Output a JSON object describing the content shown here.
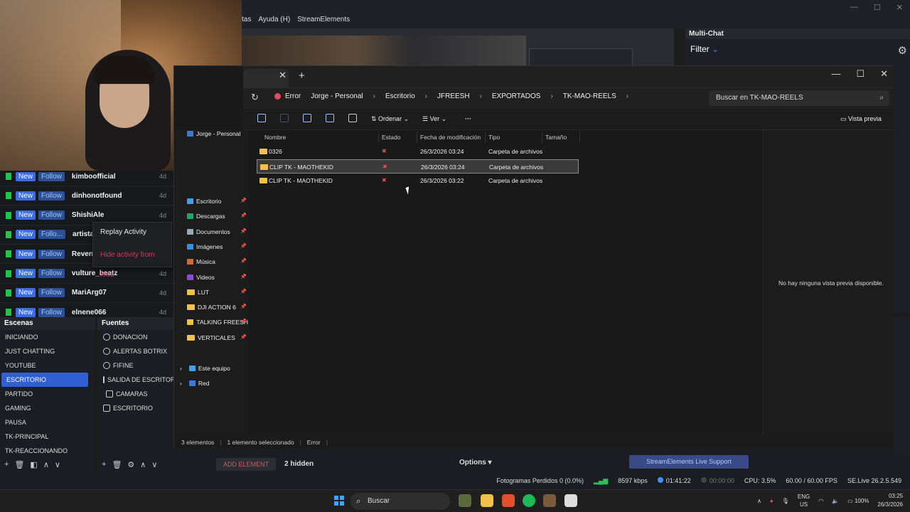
{
  "obs": {
    "menu": [
      "tas",
      "Ayuda (H)",
      "StreamElements"
    ],
    "feed": [
      {
        "badge_new": "New",
        "badge_follow": "Follow",
        "name": "kimboofficial",
        "time": "4d"
      },
      {
        "badge_new": "New",
        "badge_follow": "Follow",
        "name": "dinhonotfound",
        "time": "4d"
      },
      {
        "badge_new": "New",
        "badge_follow": "Follow",
        "name": "ShishiAle",
        "time": "4d"
      },
      {
        "badge_new": "New",
        "badge_follow": "Follo...",
        "name": "artistac",
        "time": ""
      },
      {
        "badge_new": "New",
        "badge_follow": "Follow",
        "name": "RevenC",
        "time": ""
      },
      {
        "badge_new": "New",
        "badge_follow": "Follow",
        "name": "vulture_beatz",
        "time": "4d"
      },
      {
        "badge_new": "New",
        "badge_follow": "Follow",
        "name": "MariArg07",
        "time": "4d"
      },
      {
        "badge_new": "New",
        "badge_follow": "Follow",
        "name": "elnene066",
        "time": "4d"
      }
    ],
    "feed_menu": {
      "replay": "Replay Activity",
      "hide": "Hide activity from feed"
    },
    "scenes": {
      "title": "Escenas",
      "items": [
        "INICIANDO",
        "JUST CHATTING",
        "YOUTUBE",
        "ESCRITORIO",
        "PARTIDO",
        "GAMING",
        "PAUSA",
        "TK-PRINCIPAL",
        "TK-REACCIONANDO"
      ],
      "active": "ESCRITORIO"
    },
    "sources": {
      "title": "Fuentes",
      "items": [
        "DONACION",
        "ALERTAS BOTRIX",
        "FIFINE",
        "SALIDA DE ESCRITORIO",
        "CAMARAS",
        "ESCRITORIO"
      ]
    },
    "add_element": "ADD ELEMENT",
    "hidden_count": "2 hidden",
    "options": "Options",
    "se_support": "StreamElements Live Support",
    "multichat_title": "Multi-Chat",
    "multichat_filter": "Filter",
    "status": {
      "dropped": "Fotogramas Perdidos 0 (0.0%)",
      "bitrate": "8597 kbps",
      "live_time": "01:41:22",
      "rec_time": "00:00:00",
      "cpu": "CPU: 3.5%",
      "fps": "60.00 / 60.00 FPS",
      "version": "SE.Live 26.2.5.549"
    }
  },
  "explorer": {
    "breadcrumb": [
      "Error",
      "Jorge - Personal",
      "Escritorio",
      "JFREESH",
      "EXPORTADOS",
      "TK-MAO-REELS"
    ],
    "search_placeholder": "Buscar en TK-MAO-REELS",
    "toolbar": {
      "sort": "Ordenar",
      "view": "Ver",
      "preview": "Vista previa"
    },
    "sidebar": {
      "top": "Jorge - Personal",
      "quick": [
        {
          "label": "Escritorio",
          "icon": "desktop-icon"
        },
        {
          "label": "Descargas",
          "icon": "download-icon"
        },
        {
          "label": "Documentos",
          "icon": "documents-icon"
        },
        {
          "label": "Imágenes",
          "icon": "pictures-icon"
        },
        {
          "label": "Música",
          "icon": "music-icon"
        },
        {
          "label": "Videos",
          "icon": "videos-icon"
        },
        {
          "label": "LUT",
          "icon": "folder-icon"
        },
        {
          "label": "DJI ACTION 6",
          "icon": "folder-icon"
        },
        {
          "label": "TALKING FREESH",
          "icon": "folder-icon"
        },
        {
          "label": "VERTICALES",
          "icon": "folder-icon"
        }
      ],
      "this_pc": "Este equipo",
      "network": "Red"
    },
    "columns": {
      "name": "Nombre",
      "status": "Estado",
      "modified": "Fecha de modificación",
      "type": "Tipo",
      "size": "Tamaño"
    },
    "files": [
      {
        "name": "0326",
        "modified": "26/3/2026 03:24",
        "type": "Carpeta de archivos",
        "selected": false
      },
      {
        "name": "CLIP TK - MAOTHEKID",
        "modified": "26/3/2026 03:24",
        "type": "Carpeta de archivos",
        "selected": true
      },
      {
        "name": "CLIP TK - MAOTHEKID",
        "modified": "26/3/2026 03:22",
        "type": "Carpeta de archivos",
        "selected": false
      }
    ],
    "preview_message": "No hay ninguna vista previa disponible.",
    "status": {
      "count": "3 elementos",
      "selected": "1 elemento seleccionado",
      "state": "Error"
    }
  },
  "taskbar": {
    "search": "Buscar",
    "lang": "ENG",
    "region": "US",
    "battery": "100%",
    "time": "03:25",
    "date": "26/3/2026"
  },
  "colors": {
    "accent": "#2f5fd0",
    "folder": "#f2c14a",
    "error": "#e24c5c",
    "twitch_green": "#24c24a"
  }
}
